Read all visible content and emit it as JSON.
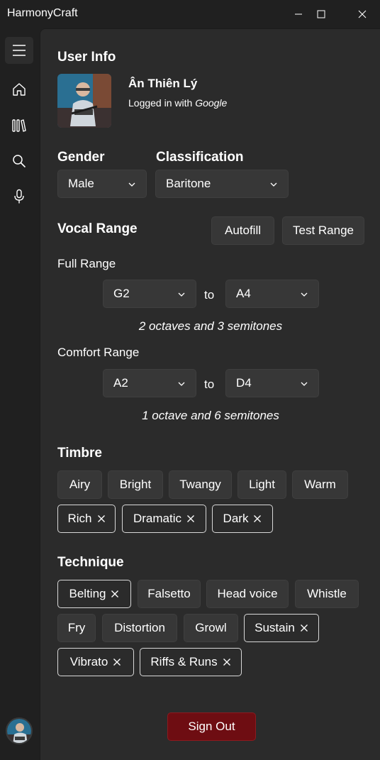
{
  "window": {
    "title": "HarmonyCraft"
  },
  "sidebar": {
    "items": [
      {
        "name": "menu",
        "icon": "hamburger-icon"
      },
      {
        "name": "home",
        "icon": "home-icon"
      },
      {
        "name": "library",
        "icon": "library-icon"
      },
      {
        "name": "search",
        "icon": "search-icon"
      },
      {
        "name": "microphone",
        "icon": "microphone-icon"
      }
    ]
  },
  "user_info": {
    "heading": "User Info",
    "name": "Ân Thiên Lý",
    "login_prefix": "Logged in with ",
    "login_provider": "Google"
  },
  "gender": {
    "label": "Gender",
    "value": "Male"
  },
  "classification": {
    "label": "Classification",
    "value": "Baritone"
  },
  "vocal_range": {
    "heading": "Vocal Range",
    "autofill_label": "Autofill",
    "test_label": "Test Range",
    "full": {
      "label": "Full Range",
      "from": "G2",
      "to_text": "to",
      "to": "A4",
      "summary": "2 octaves and 3 semitones"
    },
    "comfort": {
      "label": "Comfort Range",
      "from": "A2",
      "to_text": "to",
      "to": "D4",
      "summary": "1 octave and 6 semitones"
    }
  },
  "timbre": {
    "heading": "Timbre",
    "chips": [
      {
        "label": "Airy",
        "selected": false
      },
      {
        "label": "Bright",
        "selected": false
      },
      {
        "label": "Twangy",
        "selected": false
      },
      {
        "label": "Light",
        "selected": false
      },
      {
        "label": "Warm",
        "selected": false
      },
      {
        "label": "Rich",
        "selected": true
      },
      {
        "label": "Dramatic",
        "selected": true
      },
      {
        "label": "Dark",
        "selected": true
      }
    ]
  },
  "technique": {
    "heading": "Technique",
    "chips": [
      {
        "label": "Belting",
        "selected": true
      },
      {
        "label": "Falsetto",
        "selected": false
      },
      {
        "label": "Head voice",
        "selected": false
      },
      {
        "label": "Whistle",
        "selected": false
      },
      {
        "label": "Fry",
        "selected": false
      },
      {
        "label": "Distortion",
        "selected": false
      },
      {
        "label": "Growl",
        "selected": false
      },
      {
        "label": "Sustain",
        "selected": true
      },
      {
        "label": "Vibrato",
        "selected": true
      },
      {
        "label": "Riffs & Runs",
        "selected": true
      }
    ]
  },
  "sign_out_label": "Sign Out",
  "colors": {
    "background": "#202020",
    "panel": "#2b2b2b",
    "control": "#373737",
    "danger": "#6e0d12",
    "text": "#ffffff"
  }
}
